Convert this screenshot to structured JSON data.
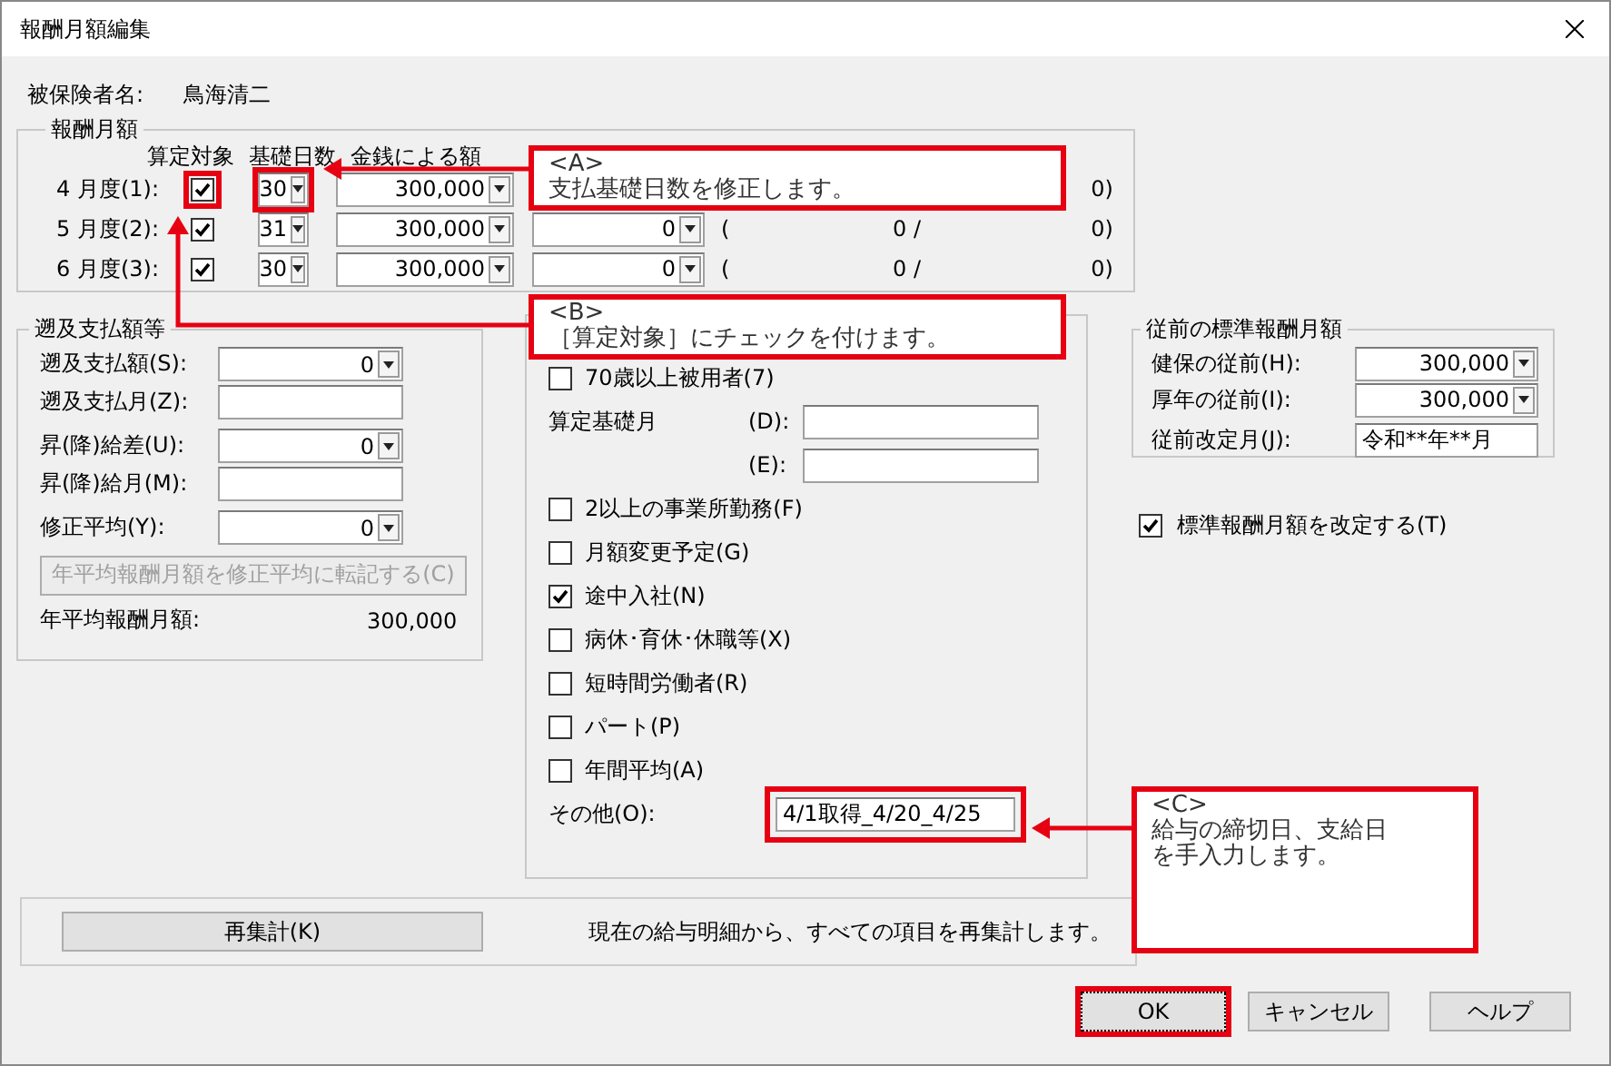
{
  "window": {
    "title": "報酬月額編集"
  },
  "insured": {
    "label": "被保険者名:",
    "name": "鳥海清二"
  },
  "monthly": {
    "title": "報酬月額",
    "headers": [
      "算定対象",
      "基礎日数",
      "金銭による額"
    ],
    "rows": [
      {
        "label": "4 月度(1):",
        "checked": true,
        "days": "30",
        "amount": "300,000",
        "marked_check": true,
        "marked_days": true,
        "end": "0)"
      },
      {
        "label": "5 月度(2):",
        "checked": true,
        "days": "31",
        "amount": "300,000",
        "marked_check": false,
        "marked_days": false,
        "other": "0",
        "paren": "(",
        "middle": "0 /",
        "end": "0)"
      },
      {
        "label": "6 月度(3):",
        "checked": true,
        "days": "30",
        "amount": "300,000",
        "marked_check": false,
        "marked_days": false,
        "other": "0",
        "paren": "(",
        "middle": "0 /",
        "end": "0)"
      }
    ]
  },
  "retro": {
    "title": "遡及支払額等",
    "fields": [
      {
        "kind": "spin",
        "label": "遡及支払額(S):",
        "value": "0"
      },
      {
        "kind": "text",
        "label": "遡及支払月(Z):"
      },
      {
        "kind": "spin",
        "label": "昇(降)給差(U):",
        "value": "0"
      },
      {
        "kind": "text",
        "label": "昇(降)給月(M):"
      },
      {
        "kind": "spin",
        "label": "修正平均(Y):",
        "value": "0"
      }
    ],
    "button": {
      "label": "年平均報酬月額を修正平均に転記する(C)",
      "disabled": true
    },
    "total": {
      "label": "年平均報酬月額:",
      "value": "300,000"
    }
  },
  "options": {
    "items": [
      {
        "kind": "check",
        "label": "70歳以上被用者(7)",
        "checked": false
      },
      {
        "kind": "months",
        "label": "算定基礎月",
        "fields": [
          "(D):",
          "(E):"
        ]
      },
      {
        "kind": "check",
        "label": "2以上の事業所勤務(F)",
        "checked": false
      },
      {
        "kind": "check",
        "label": "月額変更予定(G)",
        "checked": false
      },
      {
        "kind": "check",
        "label": "途中入社(N)",
        "checked": true
      },
      {
        "kind": "check",
        "label": "病休･育休･休職等(X)",
        "checked": false
      },
      {
        "kind": "check",
        "label": "短時間労働者(R)",
        "checked": false
      },
      {
        "kind": "check",
        "label": "パート(P)",
        "checked": false
      },
      {
        "kind": "check",
        "label": "年間平均(A)",
        "checked": false
      },
      {
        "kind": "text",
        "label": "その他(O):",
        "value": "4/1取得_4/20_4/25",
        "marked": true
      }
    ]
  },
  "previous": {
    "title": "従前の標準報酬月額",
    "fields": [
      {
        "kind": "spin",
        "label": "健保の従前(H):",
        "value": "300,000"
      },
      {
        "kind": "spin",
        "label": "厚年の従前(I):",
        "value": "300,000"
      },
      {
        "kind": "text",
        "label": "従前改定月(J):",
        "value": "令和**年**月"
      }
    ],
    "revise": {
      "label": "標準報酬月額を改定する(T)",
      "checked": true
    }
  },
  "recalc": {
    "button": "再集計(K)",
    "note": "現在の給与明細から、すべての項目を再集計します。"
  },
  "buttons": [
    {
      "label": "OK",
      "marked": true
    },
    {
      "label": "キャンセル",
      "marked": false
    },
    {
      "label": "ヘルプ",
      "marked": false
    }
  ],
  "callouts": [
    {
      "tag": "<A>",
      "lines": [
        "支払基礎日数を修正します。"
      ]
    },
    {
      "tag": "<B>",
      "lines": [
        "［算定対象］にチェックを付けます。"
      ]
    },
    {
      "tag": "<C>",
      "lines": [
        "給与の締切日、支給日",
        "を手入力します。"
      ]
    }
  ]
}
